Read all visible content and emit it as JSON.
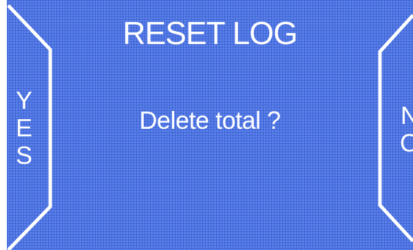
{
  "dialog": {
    "title": "RESET LOG",
    "message": "Delete total ?"
  },
  "softkeys": {
    "left": {
      "label": "YES",
      "letters": [
        "Y",
        "E",
        "S"
      ]
    },
    "right": {
      "label": "NO",
      "letters": [
        "N",
        "O"
      ]
    }
  },
  "colors": {
    "background": "#5a82ea",
    "grid": "#2846be",
    "text": "#ffffff",
    "outline": "#ffffff"
  }
}
